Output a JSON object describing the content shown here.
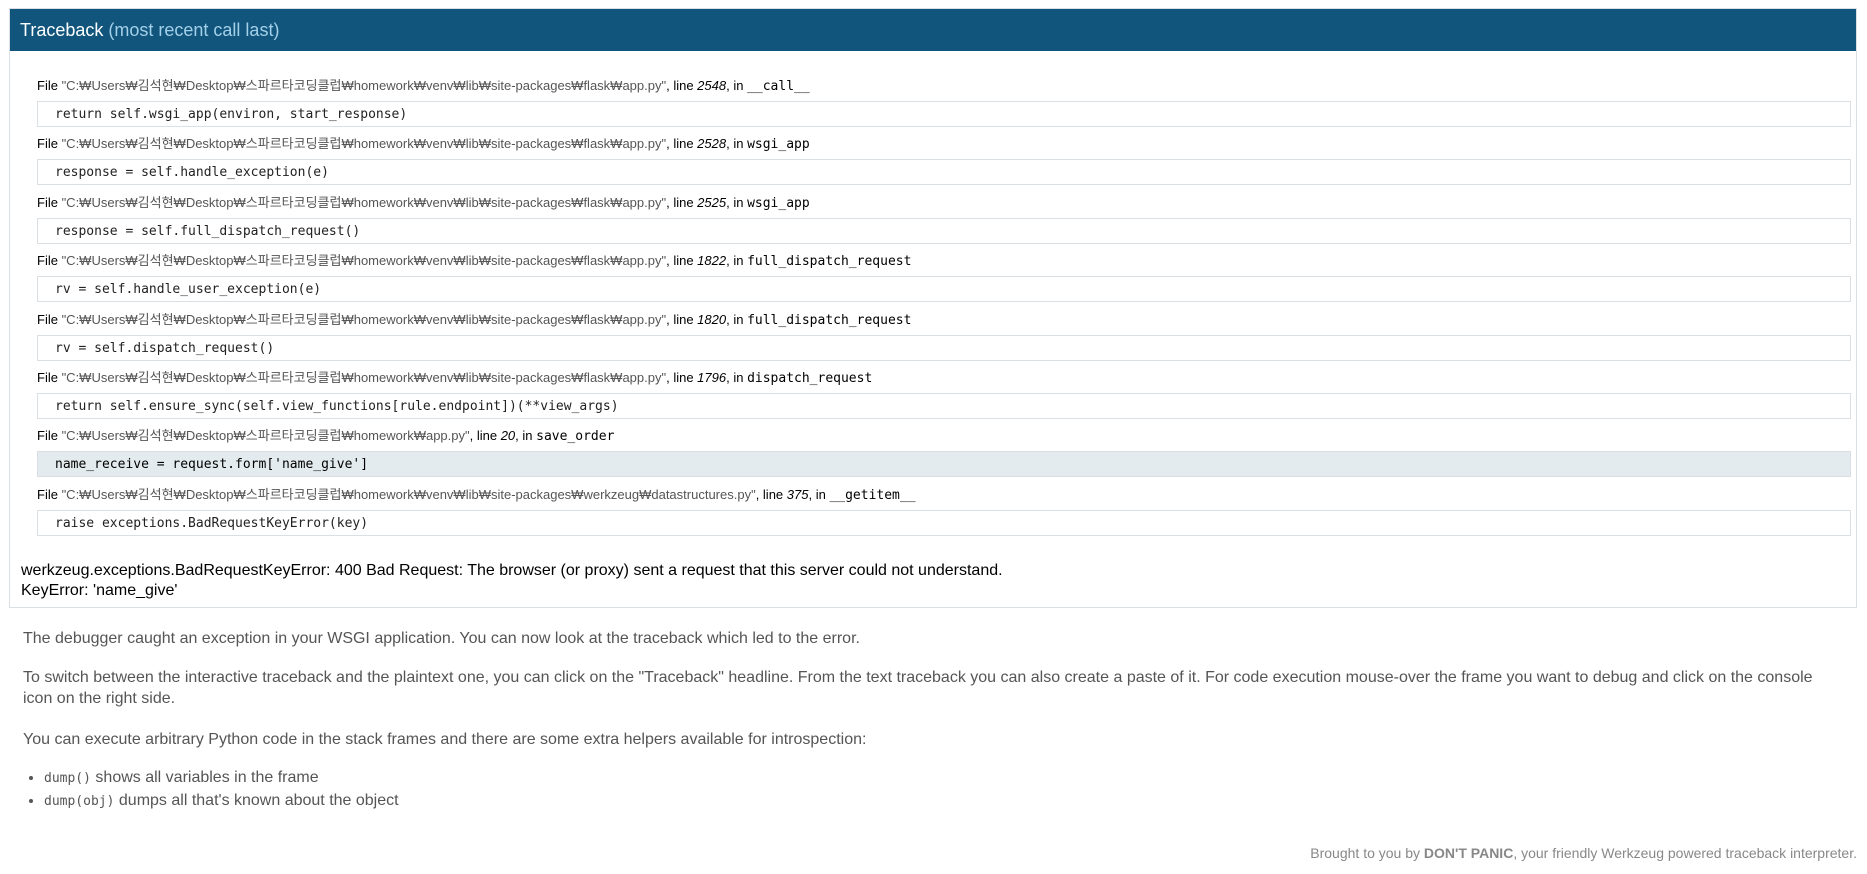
{
  "header": {
    "title": "Traceback",
    "subtitle": "(most recent call last)"
  },
  "frames": [
    {
      "prefix": "File ",
      "filename": "\"C:₩Users₩김석현₩Desktop₩스파르타코딩클럽₩homework₩venv₩lib₩site-packages₩flask₩app.py\"",
      "line_label": ", line ",
      "lineno": "2548",
      "in_label": ", in ",
      "func": "__call__",
      "code": "return self.wsgi_app(environ, start_response)",
      "current": false
    },
    {
      "prefix": "File ",
      "filename": "\"C:₩Users₩김석현₩Desktop₩스파르타코딩클럽₩homework₩venv₩lib₩site-packages₩flask₩app.py\"",
      "line_label": ", line ",
      "lineno": "2528",
      "in_label": ", in ",
      "func": "wsgi_app",
      "code": "response = self.handle_exception(e)",
      "current": false
    },
    {
      "prefix": "File ",
      "filename": "\"C:₩Users₩김석현₩Desktop₩스파르타코딩클럽₩homework₩venv₩lib₩site-packages₩flask₩app.py\"",
      "line_label": ", line ",
      "lineno": "2525",
      "in_label": ", in ",
      "func": "wsgi_app",
      "code": "response = self.full_dispatch_request()",
      "current": false
    },
    {
      "prefix": "File ",
      "filename": "\"C:₩Users₩김석현₩Desktop₩스파르타코딩클럽₩homework₩venv₩lib₩site-packages₩flask₩app.py\"",
      "line_label": ", line ",
      "lineno": "1822",
      "in_label": ", in ",
      "func": "full_dispatch_request",
      "code": "rv = self.handle_user_exception(e)",
      "current": false
    },
    {
      "prefix": "File ",
      "filename": "\"C:₩Users₩김석현₩Desktop₩스파르타코딩클럽₩homework₩venv₩lib₩site-packages₩flask₩app.py\"",
      "line_label": ", line ",
      "lineno": "1820",
      "in_label": ", in ",
      "func": "full_dispatch_request",
      "code": "rv = self.dispatch_request()",
      "current": false
    },
    {
      "prefix": "File ",
      "filename": "\"C:₩Users₩김석현₩Desktop₩스파르타코딩클럽₩homework₩venv₩lib₩site-packages₩flask₩app.py\"",
      "line_label": ", line ",
      "lineno": "1796",
      "in_label": ", in ",
      "func": "dispatch_request",
      "code": "return self.ensure_sync(self.view_functions[rule.endpoint])(**view_args)",
      "current": false
    },
    {
      "prefix": "File ",
      "filename": "\"C:₩Users₩김석현₩Desktop₩스파르타코딩클럽₩homework₩app.py\"",
      "line_label": ", line ",
      "lineno": "20",
      "in_label": ", in ",
      "func": "save_order",
      "code": "name_receive = request.form['name_give']",
      "current": true
    },
    {
      "prefix": "File ",
      "filename": "\"C:₩Users₩김석현₩Desktop₩스파르타코딩클럽₩homework₩venv₩lib₩site-packages₩werkzeug₩datastructures.py\"",
      "line_label": ", line ",
      "lineno": "375",
      "in_label": ", in ",
      "func": "__getitem__",
      "code": "raise exceptions.BadRequestKeyError(key)",
      "current": false
    }
  ],
  "exception": {
    "line1": "werkzeug.exceptions.BadRequestKeyError: 400 Bad Request: The browser (or proxy) sent a request that this server could not understand.",
    "line2": "KeyError: 'name_give'"
  },
  "explanation": {
    "p1": "The debugger caught an exception in your WSGI application. You can now look at the traceback which led to the error.",
    "p2": "To switch between the interactive traceback and the plaintext one, you can click on the \"Traceback\" headline. From the text traceback you can also create a paste of it. For code execution mouse-over the frame you want to debug and click on the console icon on the right side.",
    "p3": "You can execute arbitrary Python code in the stack frames and there are some extra helpers available for introspection:",
    "helpers": [
      {
        "code": "dump()",
        "text": " shows all variables in the frame"
      },
      {
        "code": "dump(obj)",
        "text": " dumps all that's known about the object"
      }
    ]
  },
  "footer": {
    "prefix": "Brought to you by ",
    "brand": "DON'T PANIC",
    "suffix": ", your friendly Werkzeug powered traceback interpreter."
  },
  "colors": {
    "header_bg": "#11557c",
    "header_sub": "#a3d0e8",
    "current_line_bg": "#e3ebef"
  }
}
